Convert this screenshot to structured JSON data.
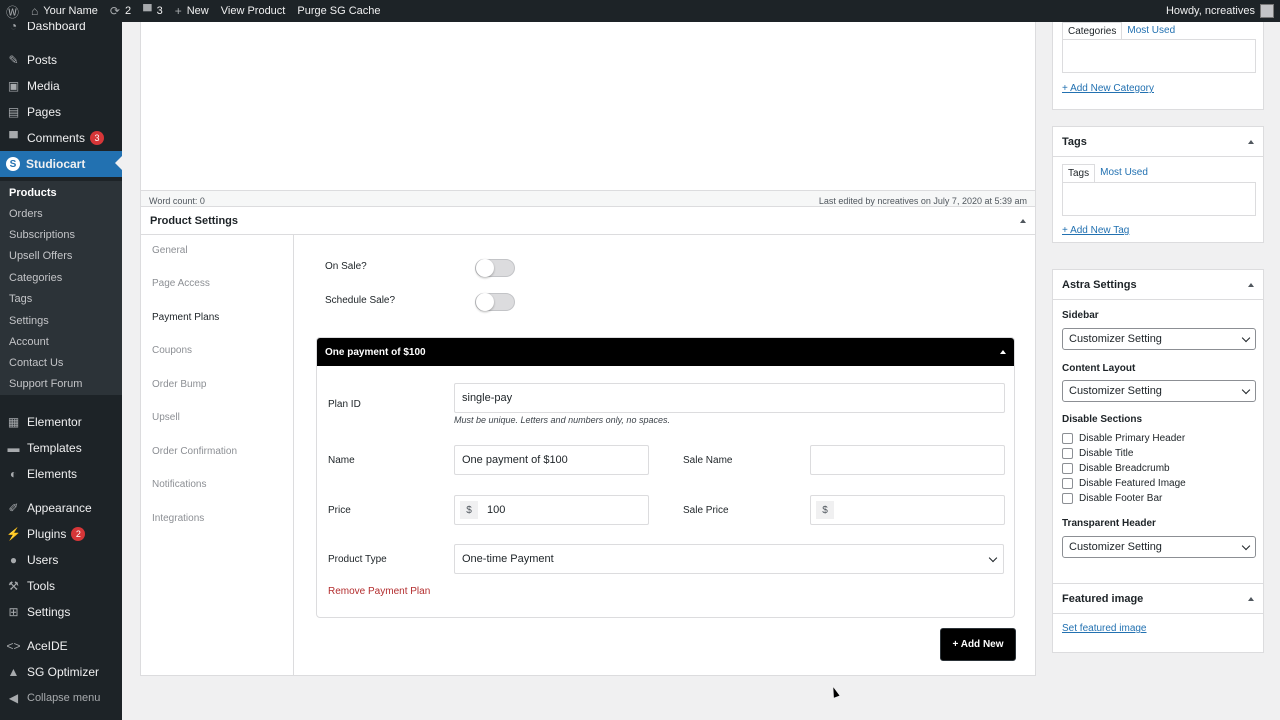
{
  "adminbar": {
    "site_name": "Your Name",
    "updates_count": "2",
    "comments_count": "3",
    "new_label": "New",
    "view_product": "View Product",
    "purge_cache": "Purge SG Cache",
    "howdy": "Howdy, ncreatives"
  },
  "sidebar": {
    "dashboard": "Dashboard",
    "posts": "Posts",
    "media": "Media",
    "pages": "Pages",
    "comments": "Comments",
    "comments_badge": "3",
    "studiocart": "Studiocart",
    "submenu": [
      "Products",
      "Orders",
      "Subscriptions",
      "Upsell Offers",
      "Categories",
      "Tags",
      "Settings",
      "Account",
      "Contact Us",
      "Support Forum"
    ],
    "elementor": "Elementor",
    "templates": "Templates",
    "elements": "Elements",
    "appearance": "Appearance",
    "plugins": "Plugins",
    "plugins_badge": "2",
    "users": "Users",
    "tools": "Tools",
    "settings": "Settings",
    "aceide": "AceIDE",
    "sg_optimizer": "SG Optimizer",
    "collapse": "Collapse menu"
  },
  "editor": {
    "word_count": "Word count: 0",
    "last_edited": "Last edited by ncreatives on July 7, 2020 at 5:39 am"
  },
  "product_settings": {
    "title": "Product Settings",
    "tabs": [
      "General",
      "Page Access",
      "Payment Plans",
      "Coupons",
      "Order Bump",
      "Upsell",
      "Order Confirmation",
      "Notifications",
      "Integrations"
    ],
    "on_sale_label": "On Sale?",
    "schedule_sale_label": "Schedule Sale?",
    "plan": {
      "header": "One payment of $100",
      "plan_id_label": "Plan ID",
      "plan_id_value": "single-pay",
      "plan_id_hint": "Must be unique. Letters and numbers only, no spaces.",
      "name_label": "Name",
      "name_value": "One payment of $100",
      "sale_name_label": "Sale Name",
      "sale_name_value": "",
      "price_label": "Price",
      "currency": "$",
      "price_value": "100",
      "sale_price_label": "Sale Price",
      "sale_price_value": "",
      "product_type_label": "Product Type",
      "product_type_value": "One-time Payment",
      "remove_label": "Remove Payment Plan"
    },
    "add_new_label": "+ Add New"
  },
  "right": {
    "categories_tab": "Categories",
    "most_used_tab": "Most Used",
    "add_category": "+ Add New Category",
    "tags_title": "Tags",
    "tags_tab": "Tags",
    "tags_most_used": "Most Used",
    "add_tag": "+ Add New Tag",
    "astra_title": "Astra Settings",
    "sidebar_label": "Sidebar",
    "sidebar_value": "Customizer Setting",
    "content_layout_label": "Content Layout",
    "content_layout_value": "Customizer Setting",
    "disable_sections_label": "Disable Sections",
    "disable_options": [
      "Disable Primary Header",
      "Disable Title",
      "Disable Breadcrumb",
      "Disable Featured Image",
      "Disable Footer Bar"
    ],
    "transparent_header_label": "Transparent Header",
    "transparent_header_value": "Customizer Setting",
    "featured_title": "Featured image",
    "set_featured": "Set featured image"
  }
}
